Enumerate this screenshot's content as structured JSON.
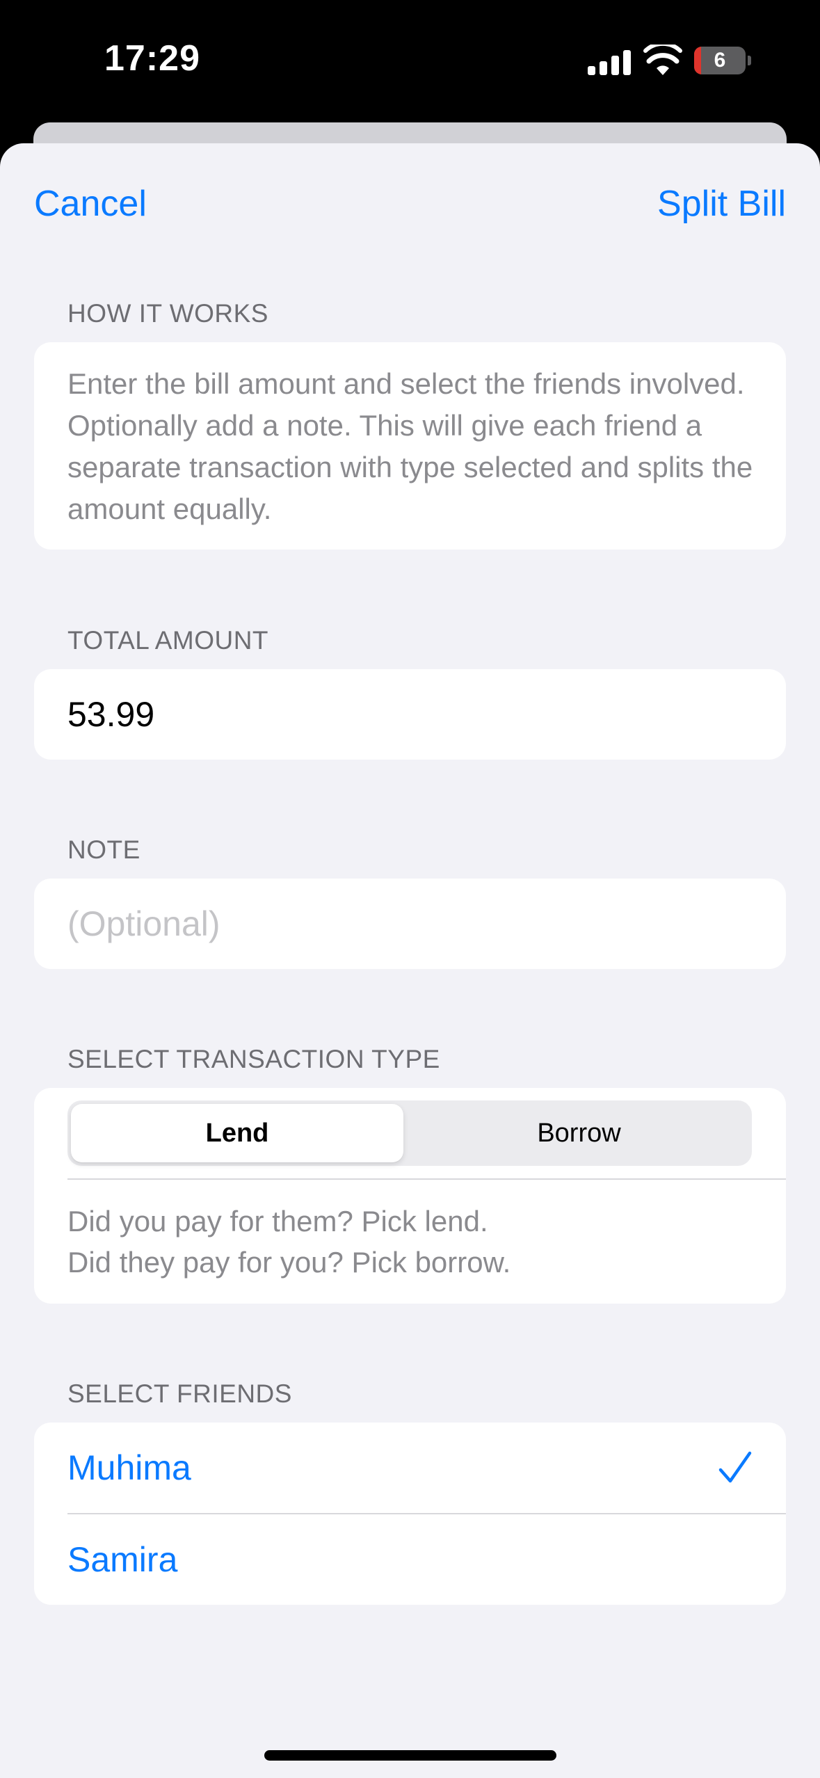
{
  "status_bar": {
    "time": "17:29",
    "battery_level": "6",
    "icons": [
      "cellular-signal-icon",
      "wifi-icon",
      "battery-icon"
    ]
  },
  "nav": {
    "cancel_label": "Cancel",
    "confirm_label": "Split Bill"
  },
  "how_it_works": {
    "header": "HOW IT WORKS",
    "text": "Enter the bill amount and select the friends involved. Optionally add a note. This will give each friend a separate transaction with type selected and splits the amount equally."
  },
  "total_amount": {
    "header": "TOTAL AMOUNT",
    "value": "53.99"
  },
  "note": {
    "header": "NOTE",
    "value": "",
    "placeholder": "(Optional)"
  },
  "transaction_type": {
    "header": "SELECT TRANSACTION TYPE",
    "options": [
      {
        "label": "Lend",
        "selected": true
      },
      {
        "label": "Borrow",
        "selected": false
      }
    ],
    "hint_line1": "Did you pay for them? Pick lend.",
    "hint_line2": "Did they pay for you? Pick borrow."
  },
  "friends": {
    "header": "SELECT FRIENDS",
    "items": [
      {
        "name": "Muhima",
        "selected": true
      },
      {
        "name": "Samira",
        "selected": false
      }
    ]
  },
  "colors": {
    "accent": "#0a7aff",
    "background": "#f2f2f7",
    "card": "#ffffff",
    "secondary_text": "#8a8a8e",
    "section_header": "#6d6d72"
  }
}
